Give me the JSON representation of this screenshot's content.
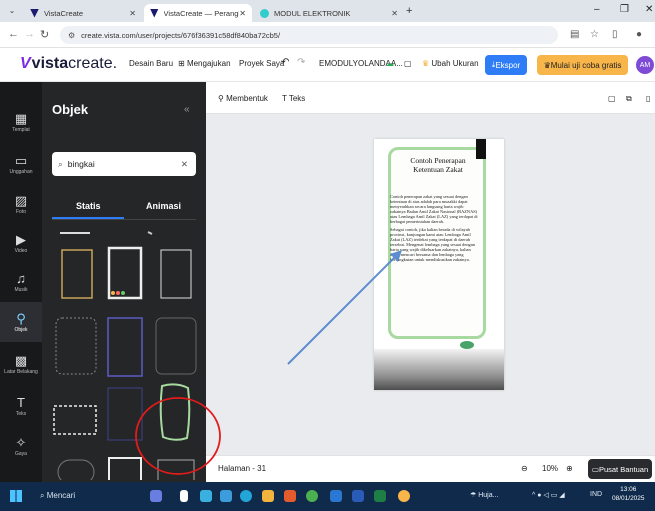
{
  "browser": {
    "tabs": [
      {
        "title": "VistaCreate",
        "active": false
      },
      {
        "title": "VistaCreate — Perangkat Lunak",
        "active": true
      },
      {
        "title": "MODUL ELEKTRONIK",
        "active": false
      }
    ],
    "url": "create.vista.com/user/projects/676f36391c58df840ba72cb5/"
  },
  "header": {
    "logo_bold": "vista",
    "logo_light": "create.",
    "items": [
      "Desain Baru",
      "Mengajukan",
      "Proyek Saya"
    ],
    "doc_name": "EMODULYOLANDAA...",
    "resize": "Ubah Ukuran",
    "export": "Ekspor",
    "trial": "Mulai uji coba gratis",
    "avatar": "AM"
  },
  "rail": [
    {
      "label": "Templat",
      "icon": "template-icon"
    },
    {
      "label": "Unggahan",
      "icon": "upload-icon"
    },
    {
      "label": "Foto",
      "icon": "photo-icon"
    },
    {
      "label": "Video",
      "icon": "video-icon"
    },
    {
      "label": "Musik",
      "icon": "music-icon"
    },
    {
      "label": "Objek",
      "icon": "object-icon"
    },
    {
      "label": "Latar Belakang",
      "icon": "background-icon"
    },
    {
      "label": "Teks",
      "icon": "text-icon"
    },
    {
      "label": "Gaya",
      "icon": "style-icon"
    }
  ],
  "panel": {
    "title": "Objek",
    "search_value": "bingkai",
    "tabs": [
      "Statis",
      "Animasi"
    ]
  },
  "toolbar": {
    "shape": "Membentuk",
    "text": "Teks"
  },
  "page": {
    "title": "Contoh Penerapan Ketentuan Zakat",
    "body_1": "Contoh penerapan zakat yang sesuai dengan ketentuan di atas adalah para muzakki dapat menyerahkan secara langsung harta wajib zakatnya Badan Amil Zakat Nasional (BAZNAS) atau Lembaga Amil Zakat (LAZ) yang terdapat di berbagai pemerintahan daerah.",
    "body_2": "Sebagai contoh, jika kalian berada di wilayah provinsi, kunjungan kami atau Lembaga Amil Zakat (LAZ) terdekat yang terdapat di daerah tersebut. Mengenai lembaga yang sesuai dengan harta yang wajib dikeluarkan zakatnya, kalian dapat mencari bersama dan lembaga yang bersangkutan untuk mendiskusikan zakatnya."
  },
  "bottom": {
    "pages": "Halaman - 31",
    "zoom": "10%",
    "help": "Pusat Bantuan"
  },
  "taskbar": {
    "search": "Mencari",
    "weather": "Huja...",
    "lang": "IND",
    "time": "13:06",
    "date": "08/01/2025"
  }
}
